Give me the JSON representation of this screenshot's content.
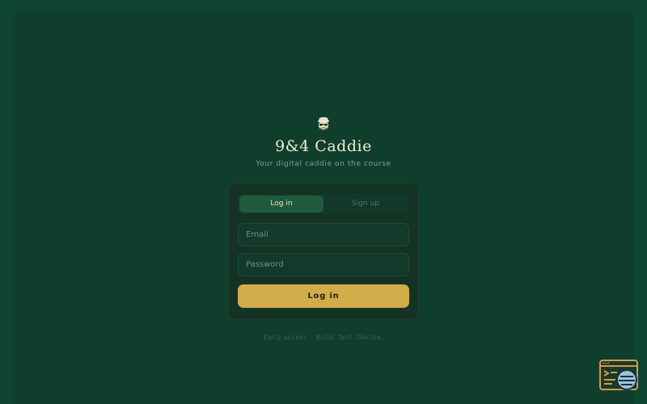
{
  "app": {
    "title": "9&4 Caddie",
    "subtitle": "Your digital caddie on the course",
    "logo_icon": "caddie-face-icon"
  },
  "auth": {
    "tabs": [
      {
        "label": "Log in",
        "active": true
      },
      {
        "label": "Sign up",
        "active": false
      }
    ],
    "email_placeholder": "Email",
    "password_placeholder": "Password",
    "submit_label": "Log in"
  },
  "footer": {
    "part1": "Early access",
    "sep": "·",
    "part2": "Build. Test. Decide."
  },
  "colors": {
    "background": "#0f4430",
    "card": "#143324",
    "accent": "#d3ac4a",
    "tab_active": "#1f5a3d"
  },
  "widget": {
    "icon": "terminal-chat-icon"
  }
}
